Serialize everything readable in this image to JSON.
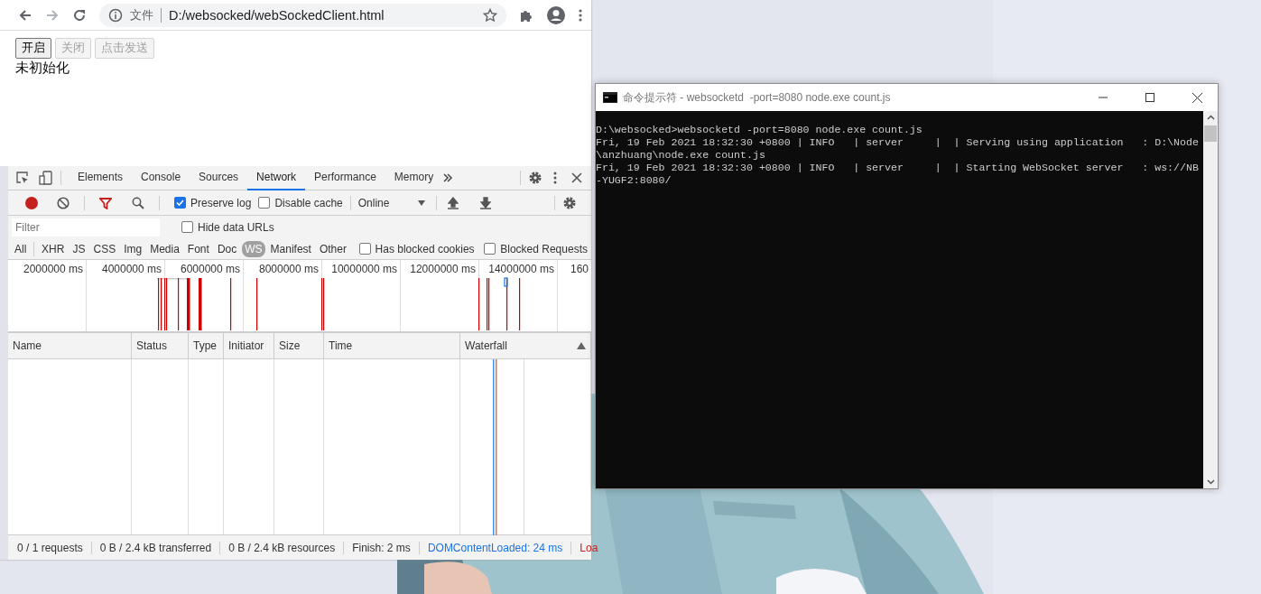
{
  "browser": {
    "address": {
      "scheme": "文件",
      "url": "D:/websocked/webSockedClient.html"
    },
    "page": {
      "buttons": [
        {
          "label": "开启",
          "disabled": false
        },
        {
          "label": "关闭",
          "disabled": true
        },
        {
          "label": "点击发送",
          "disabled": true
        }
      ],
      "status": "未初始化"
    },
    "devtools": {
      "tabs": [
        {
          "label": "Elements",
          "selected": false
        },
        {
          "label": "Console",
          "selected": false
        },
        {
          "label": "Sources",
          "selected": false
        },
        {
          "label": "Network",
          "selected": true
        },
        {
          "label": "Performance",
          "selected": false
        },
        {
          "label": "Memory",
          "selected": false
        }
      ],
      "toolbar": {
        "recording": true,
        "preserve_log": {
          "label": "Preserve log",
          "checked": true
        },
        "disable_cache": {
          "label": "Disable cache",
          "checked": false
        },
        "throttling": "Online"
      },
      "filter": {
        "placeholder": "Filter",
        "hide_data_urls": {
          "label": "Hide data URLs",
          "checked": false
        }
      },
      "type_filters": [
        {
          "label": "All",
          "selected": false
        },
        {
          "label": "XHR",
          "selected": false
        },
        {
          "label": "JS",
          "selected": false
        },
        {
          "label": "CSS",
          "selected": false
        },
        {
          "label": "Img",
          "selected": false
        },
        {
          "label": "Media",
          "selected": false
        },
        {
          "label": "Font",
          "selected": false
        },
        {
          "label": "Doc",
          "selected": false
        },
        {
          "label": "WS",
          "selected": true
        },
        {
          "label": "Manifest",
          "selected": false
        },
        {
          "label": "Other",
          "selected": false
        }
      ],
      "has_blocked_cookies": {
        "label": "Has blocked cookies",
        "checked": false
      },
      "blocked_requests": {
        "label": "Blocked Requests",
        "checked": false
      },
      "overview": {
        "ticks": [
          "2000000 ms",
          "4000000 ms",
          "6000000 ms",
          "8000000 ms",
          "10000000 ms",
          "12000000 ms",
          "14000000 ms",
          "160"
        ]
      },
      "table": {
        "columns": [
          "Name",
          "Status",
          "Type",
          "Initiator",
          "Size",
          "Time",
          "Waterfall"
        ]
      },
      "status_bar": [
        {
          "text": "0 / 1 requests",
          "kind": "plain"
        },
        {
          "text": "0 B / 2.4 kB transferred",
          "kind": "plain"
        },
        {
          "text": "0 B / 2.4 kB resources",
          "kind": "plain"
        },
        {
          "text": "Finish: 2 ms",
          "kind": "plain"
        },
        {
          "text": "DOMContentLoaded: 24 ms",
          "kind": "domcontentloaded"
        },
        {
          "text": "Loa",
          "kind": "load"
        }
      ]
    }
  },
  "console": {
    "title": "命令提示符 - websocketd  -port=8080 node.exe count.js",
    "lines": [
      "D:\\websocked>websocketd -port=8080 node.exe count.js",
      "Fri, 19 Feb 2021 18:32:30 +0800 | INFO   | server     |  | Serving using application   : D:\\Node",
      "\\anzhuang\\node.exe count.js",
      "Fri, 19 Feb 2021 18:32:30 +0800 | INFO   | server     |  | Starting WebSocket server   : ws://NB",
      "-YUGF2:8080/"
    ]
  }
}
